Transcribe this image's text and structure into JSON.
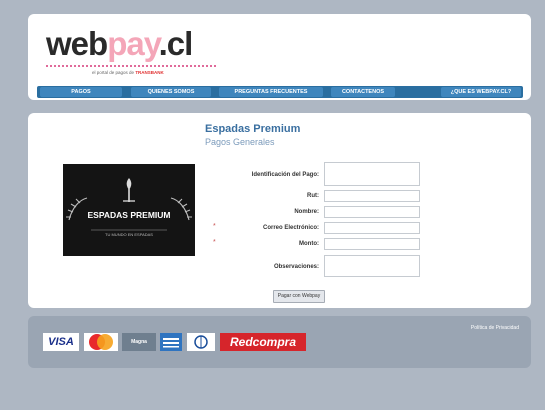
{
  "header": {
    "logo": {
      "part1": "web",
      "part2": "pay",
      "part3": ".cl"
    },
    "tagline_prefix": "el portal de pagos de",
    "tagline_brand": "TRANSBANK"
  },
  "nav": {
    "items": [
      {
        "label": "PAGOS"
      },
      {
        "label": "QUIENES SOMOS"
      },
      {
        "label": "PREGUNTAS FRECUENTES"
      },
      {
        "label": "CONTACTENOS"
      },
      {
        "label": "¿QUE ES WEBPAY.CL?"
      }
    ]
  },
  "merchant": {
    "title": "Espadas Premium",
    "subtitle": "Pagos Generales",
    "logo_text": "ESPADAS PREMIUM",
    "logo_subtext": "TU MUNDO EN ESPADAS"
  },
  "form": {
    "fields": [
      {
        "label": "Identificación del Pago:",
        "required": false,
        "multiline": true
      },
      {
        "label": "Rut:",
        "required": false,
        "multiline": false
      },
      {
        "label": "Nombre:",
        "required": false,
        "multiline": false
      },
      {
        "label": "Correo Electrónico:",
        "required": true,
        "multiline": false
      },
      {
        "label": "Monto:",
        "required": true,
        "multiline": false
      },
      {
        "label": "Observaciones:",
        "required": false,
        "multiline": true
      }
    ],
    "required_marker": "*",
    "submit_label": "Pagar con Webpay"
  },
  "footer": {
    "link_label": "Política de Privacidad",
    "payment_logos": [
      "VISA",
      "MasterCard",
      "Magna",
      "American Express",
      "Diners Club",
      "Redcompra"
    ]
  },
  "colors": {
    "page_background": "#aeb7c3",
    "nav_bar": "#2a6ea0",
    "nav_item": "#3f86bd",
    "accent_blue": "#3a6fa0",
    "redcompra_red": "#d6252b"
  }
}
